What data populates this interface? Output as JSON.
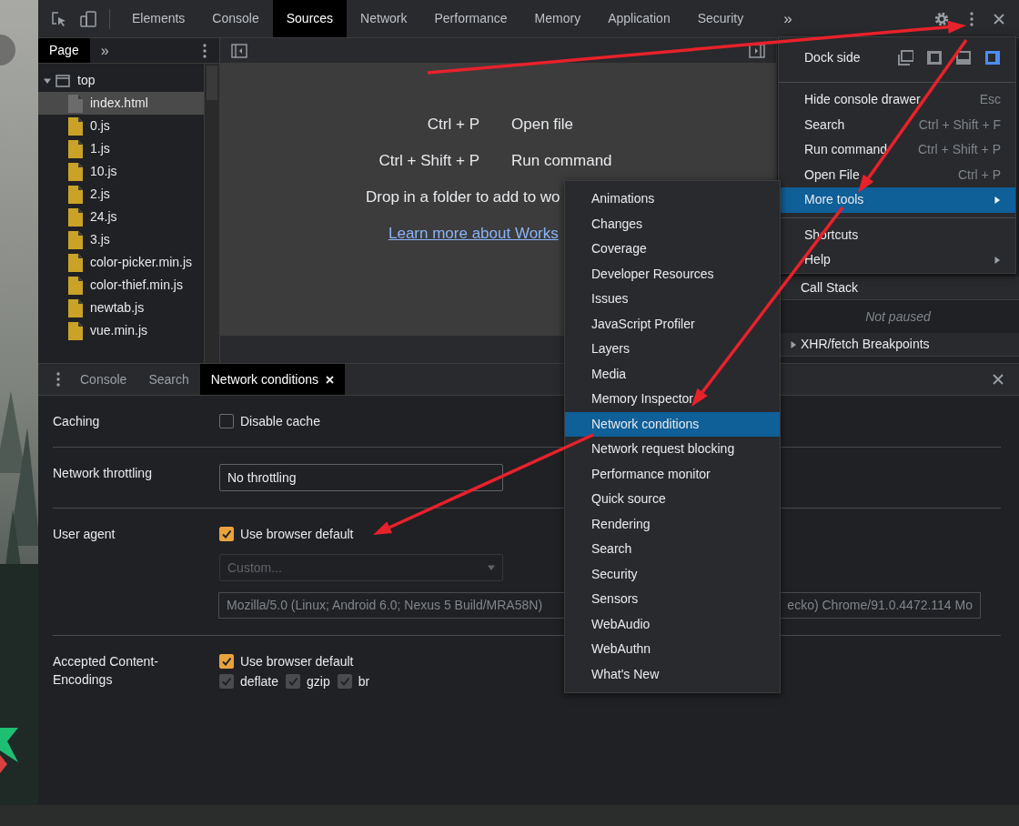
{
  "main_tabs": [
    {
      "label": "Elements",
      "selected": false
    },
    {
      "label": "Console",
      "selected": false
    },
    {
      "label": "Sources",
      "selected": true
    },
    {
      "label": "Network",
      "selected": false
    },
    {
      "label": "Performance",
      "selected": false
    },
    {
      "label": "Memory",
      "selected": false
    },
    {
      "label": "Application",
      "selected": false
    },
    {
      "label": "Security",
      "selected": false
    }
  ],
  "main_overflow": "»",
  "navigator": {
    "tabs": [
      {
        "label": "Page",
        "selected": true
      }
    ],
    "overflow": "»",
    "tree": [
      {
        "label": "top",
        "kind": "frame",
        "expanded": true,
        "selected": false,
        "children": [
          {
            "label": "index.html",
            "kind": "html",
            "selected": true
          },
          {
            "label": "0.js",
            "kind": "js",
            "selected": false
          },
          {
            "label": "1.js",
            "kind": "js",
            "selected": false
          },
          {
            "label": "10.js",
            "kind": "js",
            "selected": false
          },
          {
            "label": "2.js",
            "kind": "js",
            "selected": false
          },
          {
            "label": "24.js",
            "kind": "js",
            "selected": false
          },
          {
            "label": "3.js",
            "kind": "js",
            "selected": false
          },
          {
            "label": "color-picker.min.js",
            "kind": "js",
            "selected": false
          },
          {
            "label": "color-thief.min.js",
            "kind": "js",
            "selected": false
          },
          {
            "label": "newtab.js",
            "kind": "js",
            "selected": false
          },
          {
            "label": "vue.min.js",
            "kind": "js",
            "selected": false
          }
        ]
      }
    ]
  },
  "editor": {
    "shortcuts": [
      {
        "keys": "Ctrl + P",
        "action": "Open file"
      },
      {
        "keys": "Ctrl + Shift + P",
        "action": "Run command"
      }
    ],
    "drop_hint": "Drop in a folder to add to wo",
    "link": "Learn more about Works"
  },
  "sidebar": {
    "sections": [
      {
        "title": "Call Stack",
        "expanded": true,
        "message": "Not paused"
      },
      {
        "title": "XHR/fetch Breakpoints",
        "expanded": false
      }
    ]
  },
  "menu": {
    "dock_side": {
      "label": "Dock side",
      "options": [
        {
          "kind": "undock",
          "selected": false
        },
        {
          "kind": "left",
          "selected": false
        },
        {
          "kind": "bottom",
          "selected": false
        },
        {
          "kind": "right",
          "selected": true
        }
      ]
    },
    "groups": [
      [
        {
          "label": "Hide console drawer",
          "shortcut": "Esc",
          "submenu": false,
          "selected": false
        },
        {
          "label": "Search",
          "shortcut": "Ctrl + Shift + F",
          "submenu": false,
          "selected": false
        },
        {
          "label": "Run command",
          "shortcut": "Ctrl + Shift + P",
          "submenu": false,
          "selected": false
        },
        {
          "label": "Open File",
          "shortcut": "Ctrl + P",
          "submenu": false,
          "selected": false
        },
        {
          "label": "More tools",
          "submenu": true,
          "selected": true
        }
      ],
      [
        {
          "label": "Shortcuts",
          "submenu": false,
          "selected": false
        },
        {
          "label": "Help",
          "submenu": true,
          "selected": false
        }
      ]
    ]
  },
  "submenu": {
    "items": [
      {
        "label": "Animations",
        "selected": false
      },
      {
        "label": "Changes",
        "selected": false
      },
      {
        "label": "Coverage",
        "selected": false
      },
      {
        "label": "Developer Resources",
        "selected": false
      },
      {
        "label": "Issues",
        "selected": false
      },
      {
        "label": "JavaScript Profiler",
        "selected": false
      },
      {
        "label": "Layers",
        "selected": false
      },
      {
        "label": "Media",
        "selected": false
      },
      {
        "label": "Memory Inspector",
        "selected": false
      },
      {
        "label": "Network conditions",
        "selected": true
      },
      {
        "label": "Network request blocking",
        "selected": false
      },
      {
        "label": "Performance monitor",
        "selected": false
      },
      {
        "label": "Quick source",
        "selected": false
      },
      {
        "label": "Rendering",
        "selected": false
      },
      {
        "label": "Search",
        "selected": false
      },
      {
        "label": "Security",
        "selected": false
      },
      {
        "label": "Sensors",
        "selected": false
      },
      {
        "label": "WebAudio",
        "selected": false
      },
      {
        "label": "WebAuthn",
        "selected": false
      },
      {
        "label": "What's New",
        "selected": false
      }
    ]
  },
  "drawer": {
    "tabs": [
      {
        "label": "Console",
        "selected": false,
        "closable": false
      },
      {
        "label": "Search",
        "selected": false,
        "closable": false
      },
      {
        "label": "Network conditions",
        "selected": true,
        "closable": true
      }
    ],
    "sections": [
      {
        "label": "Caching",
        "controls": [
          {
            "kind": "checkbox",
            "label": "Disable cache",
            "checked": false,
            "disabled": false
          }
        ]
      },
      {
        "label": "Network throttling",
        "controls": [
          {
            "kind": "select",
            "value": "No throttling",
            "disabled": false
          }
        ]
      },
      {
        "label": "User agent",
        "controls": [
          {
            "kind": "checkbox",
            "label": "Use browser default",
            "checked": true,
            "disabled": false
          },
          {
            "kind": "select",
            "value": "Custom...",
            "disabled": true
          },
          {
            "kind": "text",
            "visible_start": "Mozilla/5.0 (Linux; Android 6.0; Nexus 5 Build/MRA58N)",
            "visible_end": "ecko) Chrome/91.0.4472.114 Mo",
            "disabled": true
          }
        ]
      },
      {
        "label": "Accepted Content-Encodings",
        "controls": [
          {
            "kind": "checkbox",
            "label": "Use browser default",
            "checked": true,
            "disabled": false
          },
          {
            "kind": "inline_checkboxes",
            "items": [
              {
                "label": "deflate",
                "checked": true,
                "disabled": true
              },
              {
                "label": "gzip",
                "checked": true,
                "disabled": true
              },
              {
                "label": "br",
                "checked": true,
                "disabled": true
              }
            ]
          }
        ]
      }
    ]
  }
}
